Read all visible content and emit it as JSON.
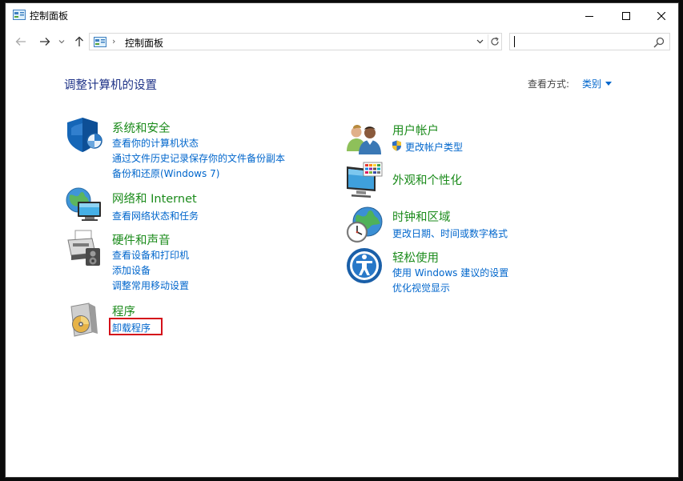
{
  "window": {
    "title": "控制面板",
    "controls": {
      "minimize": "minimize-icon",
      "maximize": "maximize-icon",
      "close": "close-icon"
    }
  },
  "navigation": {
    "breadcrumb": "控制面板",
    "search_value": "",
    "icons": [
      "back-arrow-icon",
      "forward-arrow-icon",
      "recent-dropdown-icon",
      "up-arrow-icon",
      "refresh-icon",
      "search-icon"
    ]
  },
  "main": {
    "heading": "调整计算机的设置",
    "view_by_label": "查看方式:",
    "view_by_value": "类别"
  },
  "categories": {
    "system_security": {
      "title": "系统和安全",
      "links": [
        "查看你的计算机状态",
        "通过文件历史记录保存你的文件备份副本",
        "备份和还原(Windows 7)"
      ]
    },
    "network": {
      "title": "网络和 Internet",
      "links": [
        "查看网络状态和任务"
      ]
    },
    "hardware_sound": {
      "title": "硬件和声音",
      "links": [
        "查看设备和打印机",
        "添加设备",
        "调整常用移动设置"
      ]
    },
    "programs": {
      "title": "程序",
      "links": [
        "卸载程序"
      ]
    },
    "user_accounts": {
      "title": "用户帐户",
      "links": [
        "更改帐户类型"
      ]
    },
    "appearance": {
      "title": "外观和个性化",
      "links": []
    },
    "clock_region": {
      "title": "时钟和区域",
      "links": [
        "更改日期、时间或数字格式"
      ]
    },
    "ease_of_access": {
      "title": "轻松使用",
      "links": [
        "使用 Windows 建议的设置",
        "优化视觉显示"
      ]
    }
  },
  "colors": {
    "link": "#0066cc",
    "category_title": "#1b8b1b",
    "heading": "#1e3287",
    "highlight": "#d4111a"
  }
}
